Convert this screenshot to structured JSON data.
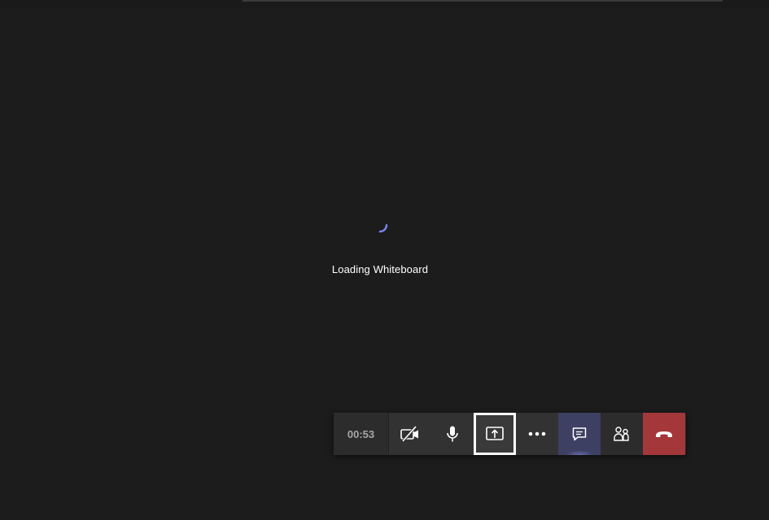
{
  "loading": {
    "text": "Loading Whiteboard",
    "spinner_icon": "spinner-icon",
    "spinner_color": "#7b83eb"
  },
  "call_controls": {
    "timer": "00:53",
    "buttons": [
      {
        "id": "camera",
        "icon": "camera-off-icon"
      },
      {
        "id": "mic",
        "icon": "microphone-icon"
      },
      {
        "id": "share",
        "icon": "share-screen-icon",
        "highlighted": true
      },
      {
        "id": "more",
        "icon": "more-options-icon"
      },
      {
        "id": "chat",
        "icon": "chat-icon",
        "active": true
      },
      {
        "id": "participants",
        "icon": "participants-icon"
      },
      {
        "id": "hangup",
        "icon": "hang-up-icon"
      }
    ],
    "colors": {
      "active_chat": "#3d3f63",
      "hangup": "#a4373a",
      "highlight_border": "#ffffff"
    }
  }
}
